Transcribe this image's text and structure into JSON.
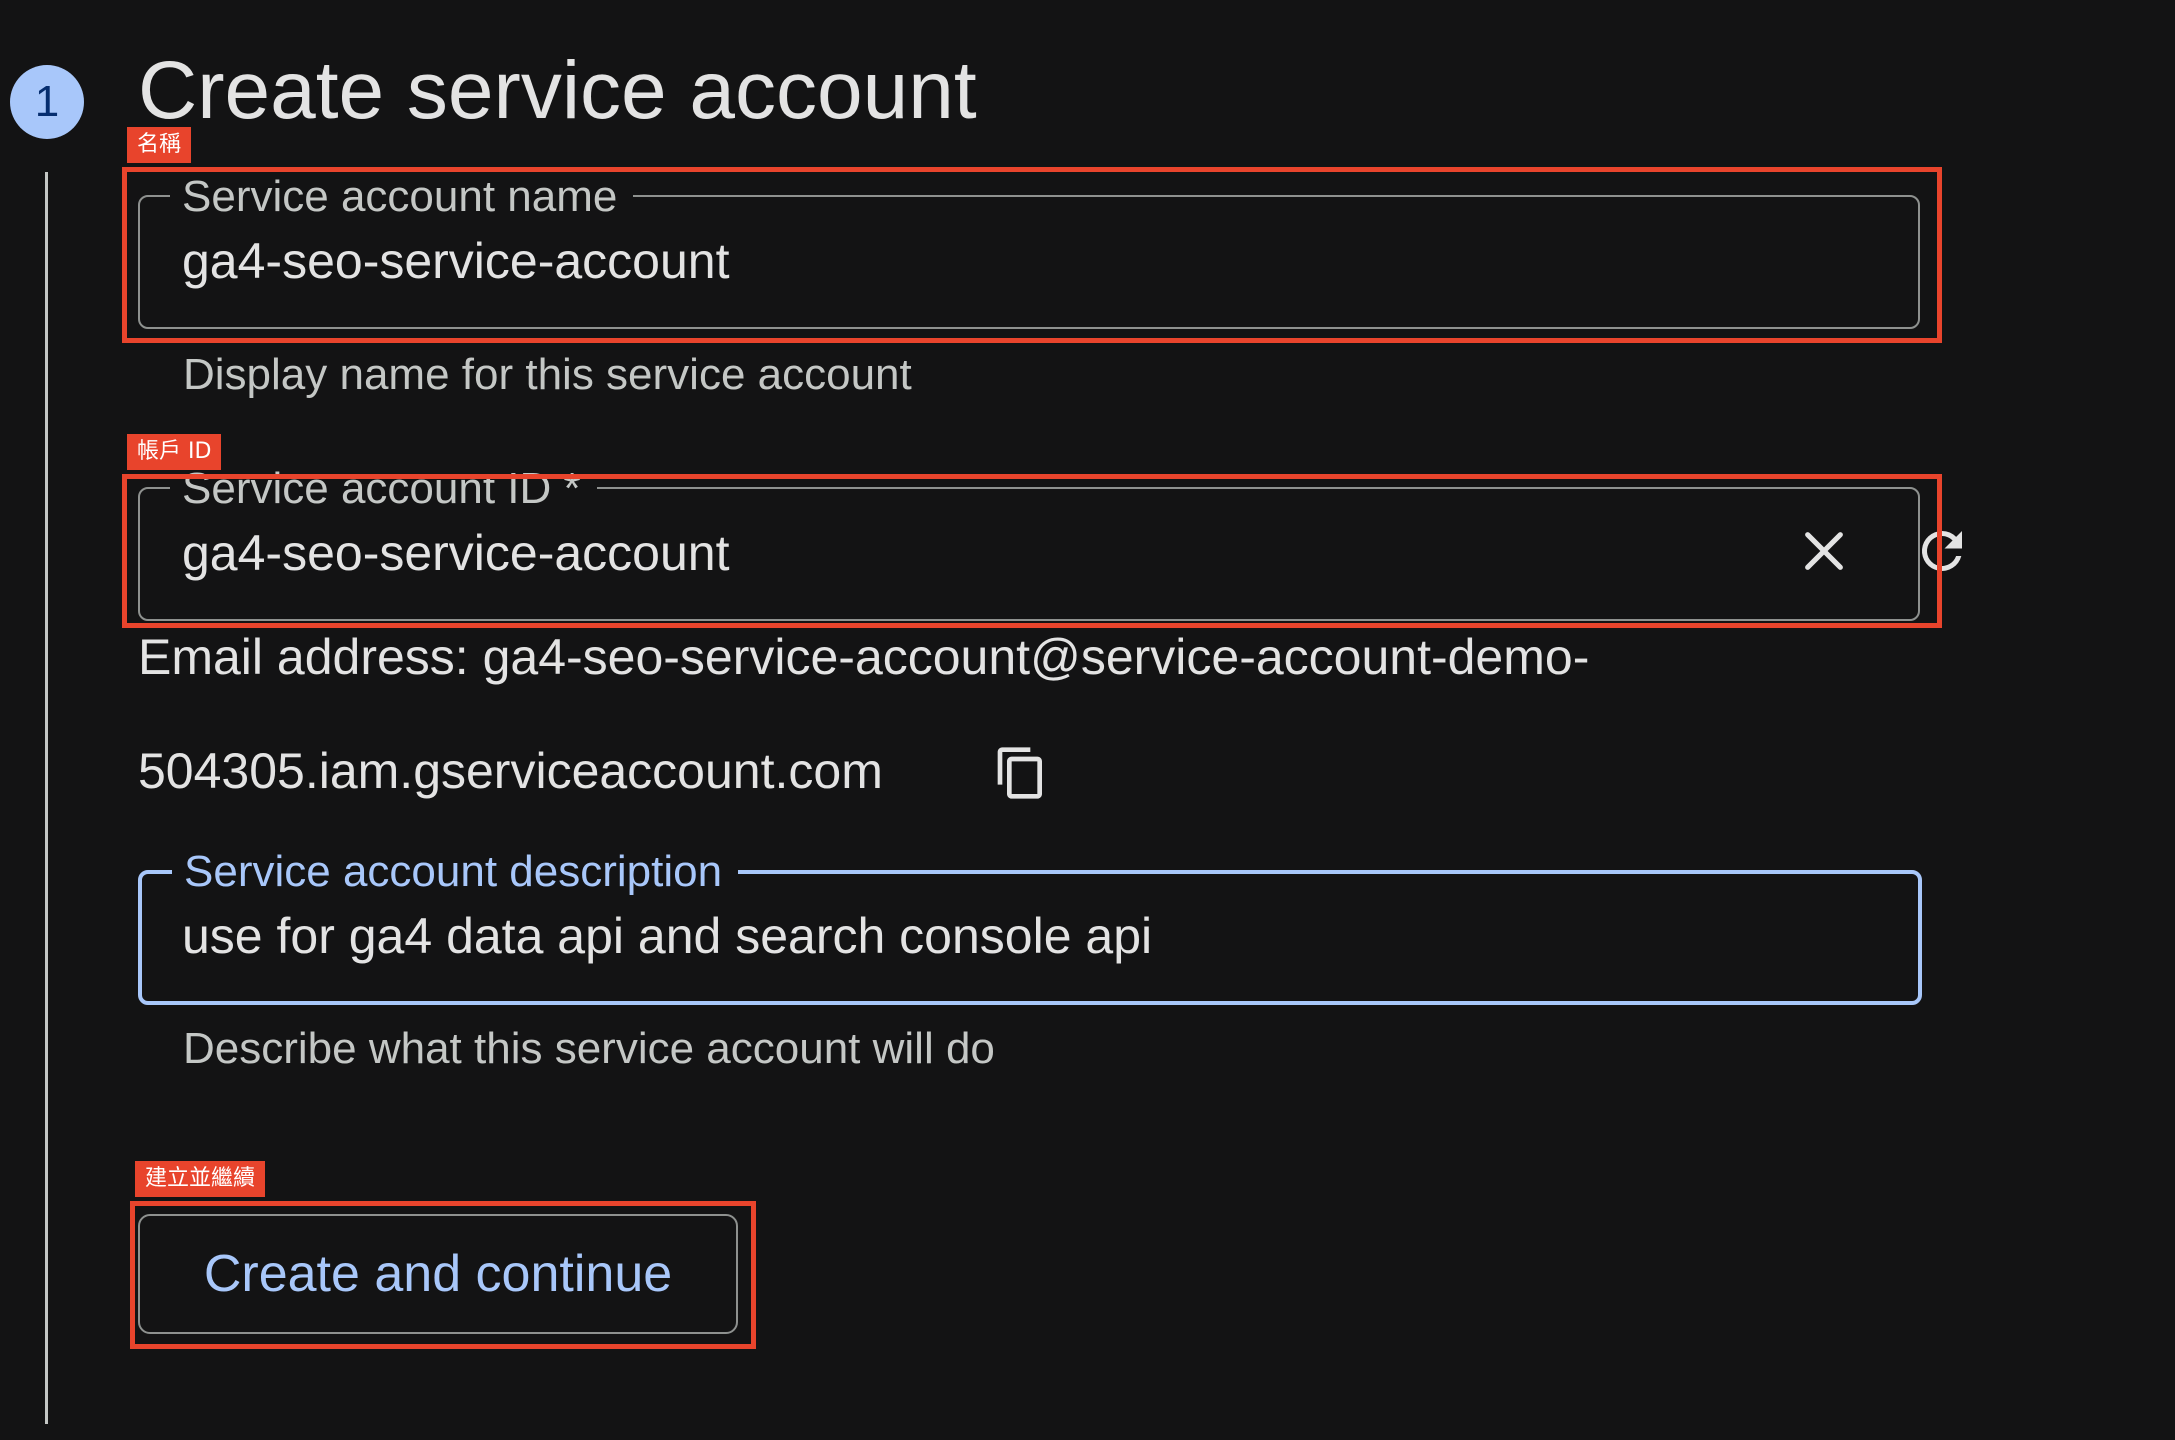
{
  "step": {
    "number": "1",
    "title": "Create service account"
  },
  "annotations": {
    "name_tag": "名稱",
    "id_tag": "帳戶 ID",
    "create_tag": "建立並繼續"
  },
  "fields": {
    "name": {
      "label": "Service account name",
      "value": "ga4-seo-service-account",
      "helper": "Display name for this service account"
    },
    "id": {
      "label": "Service account ID *",
      "value": "ga4-seo-service-account",
      "clear_icon": "close-icon",
      "regenerate_icon": "refresh-icon"
    },
    "description": {
      "label": "Service account description",
      "value": "use for ga4 data api and search console api",
      "helper": "Describe what this service account will do"
    }
  },
  "email": {
    "line1": "Email address: ga4-seo-service-account@service-account-demo-",
    "line2": "504305.iam.gserviceaccount.com",
    "copy_icon": "copy-icon"
  },
  "actions": {
    "create_label": "Create and continue"
  },
  "colors": {
    "background": "#131314",
    "accent": "#a8c7fa",
    "annotation": "#e8442c",
    "text": "#e3e3e3",
    "muted_text": "#c4c7c5"
  }
}
